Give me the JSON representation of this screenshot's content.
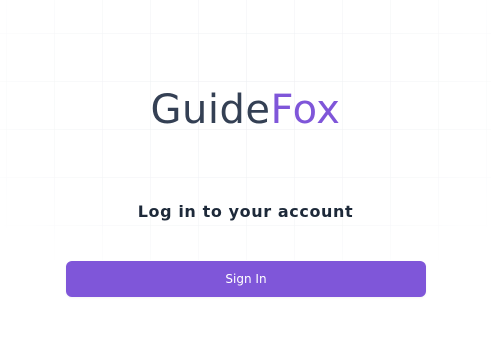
{
  "logo": {
    "part1": "Guide",
    "part2": "Fox"
  },
  "headline": "Log in to your account",
  "signin_button": {
    "label": "Sign In"
  },
  "colors": {
    "accent": "#7f56d9",
    "logo_dark": "#344054",
    "headline": "#1d2939",
    "grid_line": "#eaecf0",
    "background": "#ffffff"
  }
}
